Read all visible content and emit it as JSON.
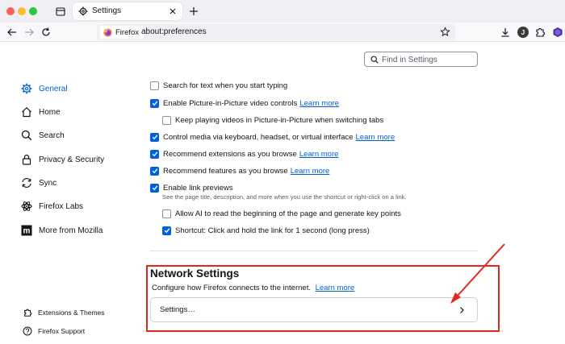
{
  "browser": {
    "tab_title": "Settings",
    "identity_label": "Firefox",
    "url": "about:preferences",
    "avatar_initial": "J"
  },
  "search": {
    "placeholder": "Find in Settings"
  },
  "sidebar": {
    "items": [
      {
        "label": "General",
        "icon": "gear-icon",
        "active": true
      },
      {
        "label": "Home",
        "icon": "home-icon"
      },
      {
        "label": "Search",
        "icon": "search-icon"
      },
      {
        "label": "Privacy & Security",
        "icon": "lock-icon"
      },
      {
        "label": "Sync",
        "icon": "sync-icon"
      },
      {
        "label": "Firefox Labs",
        "icon": "labs-icon"
      },
      {
        "label": "More from Mozilla",
        "icon": "mozilla-icon"
      }
    ],
    "footer": [
      {
        "label": "Extensions & Themes",
        "icon": "puzzle-icon"
      },
      {
        "label": "Firefox Support",
        "icon": "help-icon"
      }
    ]
  },
  "options": [
    {
      "label": "Search for text when you start typing",
      "checked": false
    },
    {
      "label": "Enable Picture-in-Picture video controls",
      "checked": true,
      "link": "Learn more"
    },
    {
      "label": "Keep playing videos in Picture-in-Picture when switching tabs",
      "checked": false
    },
    {
      "label": "Control media via keyboard, headset, or virtual interface",
      "checked": true,
      "link": "Learn more"
    },
    {
      "label": "Recommend extensions as you browse",
      "checked": true,
      "link": "Learn more"
    },
    {
      "label": "Recommend features as you browse",
      "checked": true,
      "link": "Learn more"
    },
    {
      "label": "Enable link previews",
      "checked": true
    },
    {
      "label": "Allow AI to read the beginning of the page and generate key points",
      "checked": false
    },
    {
      "label": "Shortcut: Click and hold the link for 1 second (long press)",
      "checked": true
    }
  ],
  "link_previews_description": "See the page title, description, and more when you use the shortcut or right-click on a link.",
  "network": {
    "title": "Network Settings",
    "description": "Configure how Firefox connects to the internet.",
    "link": "Learn more",
    "button_label": "Settings…"
  },
  "colors": {
    "accent": "#0061e0",
    "annotation": "#e0281f"
  }
}
